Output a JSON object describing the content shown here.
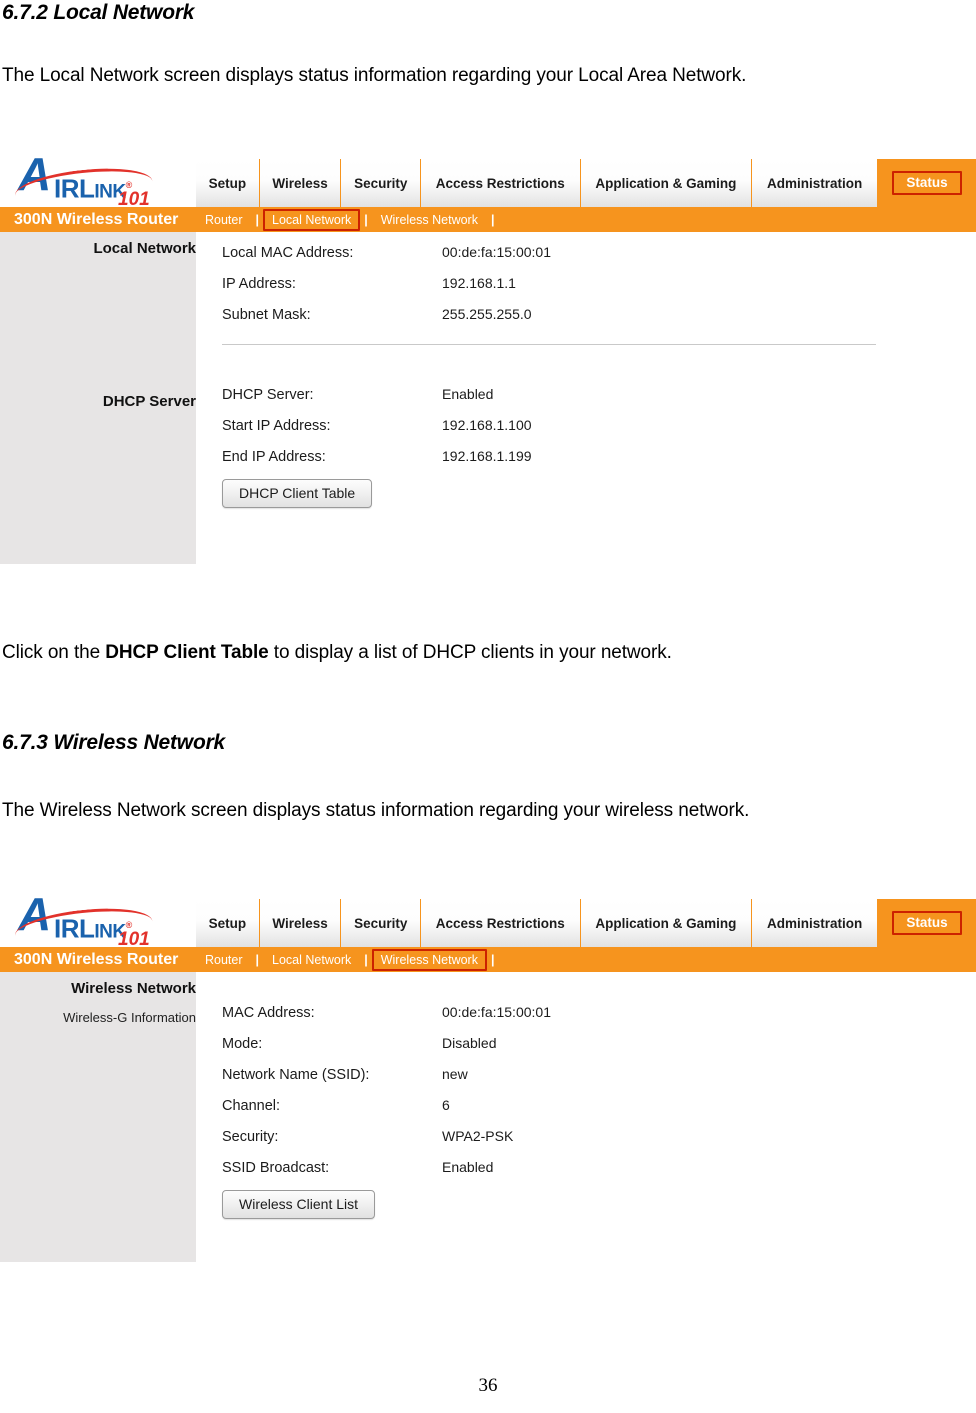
{
  "document": {
    "section1": {
      "heading": "6.7.2 Local Network",
      "paragraph": "The Local Network screen displays status information regarding your Local Area Network."
    },
    "middle": {
      "prefix": "Click on the ",
      "bold": "DHCP Client Table",
      "suffix": " to display a list of DHCP clients in your network."
    },
    "section2": {
      "heading": "6.7.3 Wireless Network",
      "paragraph": "The Wireless Network screen displays status information regarding your wireless network."
    },
    "page_number": "36"
  },
  "colors": {
    "orange": "#f6941e",
    "highlight_red": "#cc2200",
    "logo_blue": "#1a62ad",
    "logo_red": "#e2322b",
    "rail_gray": "#e7e5e5"
  },
  "router_ui": {
    "logo": {
      "letter": "A",
      "word_main": "IRL",
      "word_ink": "INK",
      "registered": "®",
      "model_number": "101"
    },
    "nav_tabs": [
      {
        "label": "Setup"
      },
      {
        "label": "Wireless"
      },
      {
        "label": "Security"
      },
      {
        "label": "Access Restrictions"
      },
      {
        "label": "Application & Gaming"
      },
      {
        "label": "Administration"
      },
      {
        "label": "Status"
      }
    ],
    "brand": "300N Wireless Router",
    "subnav": [
      {
        "label": "Router"
      },
      {
        "label": "Local Network"
      },
      {
        "label": "Wireless Network"
      }
    ]
  },
  "capture_local_network": {
    "active_tab": "Status",
    "active_subnav": "Local Network",
    "rail": {
      "title": "Local Network",
      "section2_title": "DHCP Server"
    },
    "fields_group1": [
      {
        "label": "Local MAC Address:",
        "value": "00:de:fa:15:00:01"
      },
      {
        "label": "IP Address:",
        "value": "192.168.1.1"
      },
      {
        "label": "Subnet Mask:",
        "value": "255.255.255.0"
      }
    ],
    "fields_group2": [
      {
        "label": "DHCP Server:",
        "value": "Enabled"
      },
      {
        "label": "Start IP Address:",
        "value": "192.168.1.100"
      },
      {
        "label": "End IP Address:",
        "value": "192.168.1.199"
      }
    ],
    "button": "DHCP Client Table"
  },
  "capture_wireless_network": {
    "active_tab": "Status",
    "active_subnav": "Wireless Network",
    "rail": {
      "title": "Wireless Network",
      "subtitle": "Wireless-G Information"
    },
    "fields": [
      {
        "label": "MAC Address:",
        "value": "00:de:fa:15:00:01"
      },
      {
        "label": "Mode:",
        "value": "Disabled"
      },
      {
        "label": "Network Name (SSID):",
        "value": "new"
      },
      {
        "label": "Channel:",
        "value": "6"
      },
      {
        "label": "Security:",
        "value": "WPA2-PSK"
      },
      {
        "label": "SSID Broadcast:",
        "value": "Enabled"
      }
    ],
    "button": "Wireless Client List"
  }
}
